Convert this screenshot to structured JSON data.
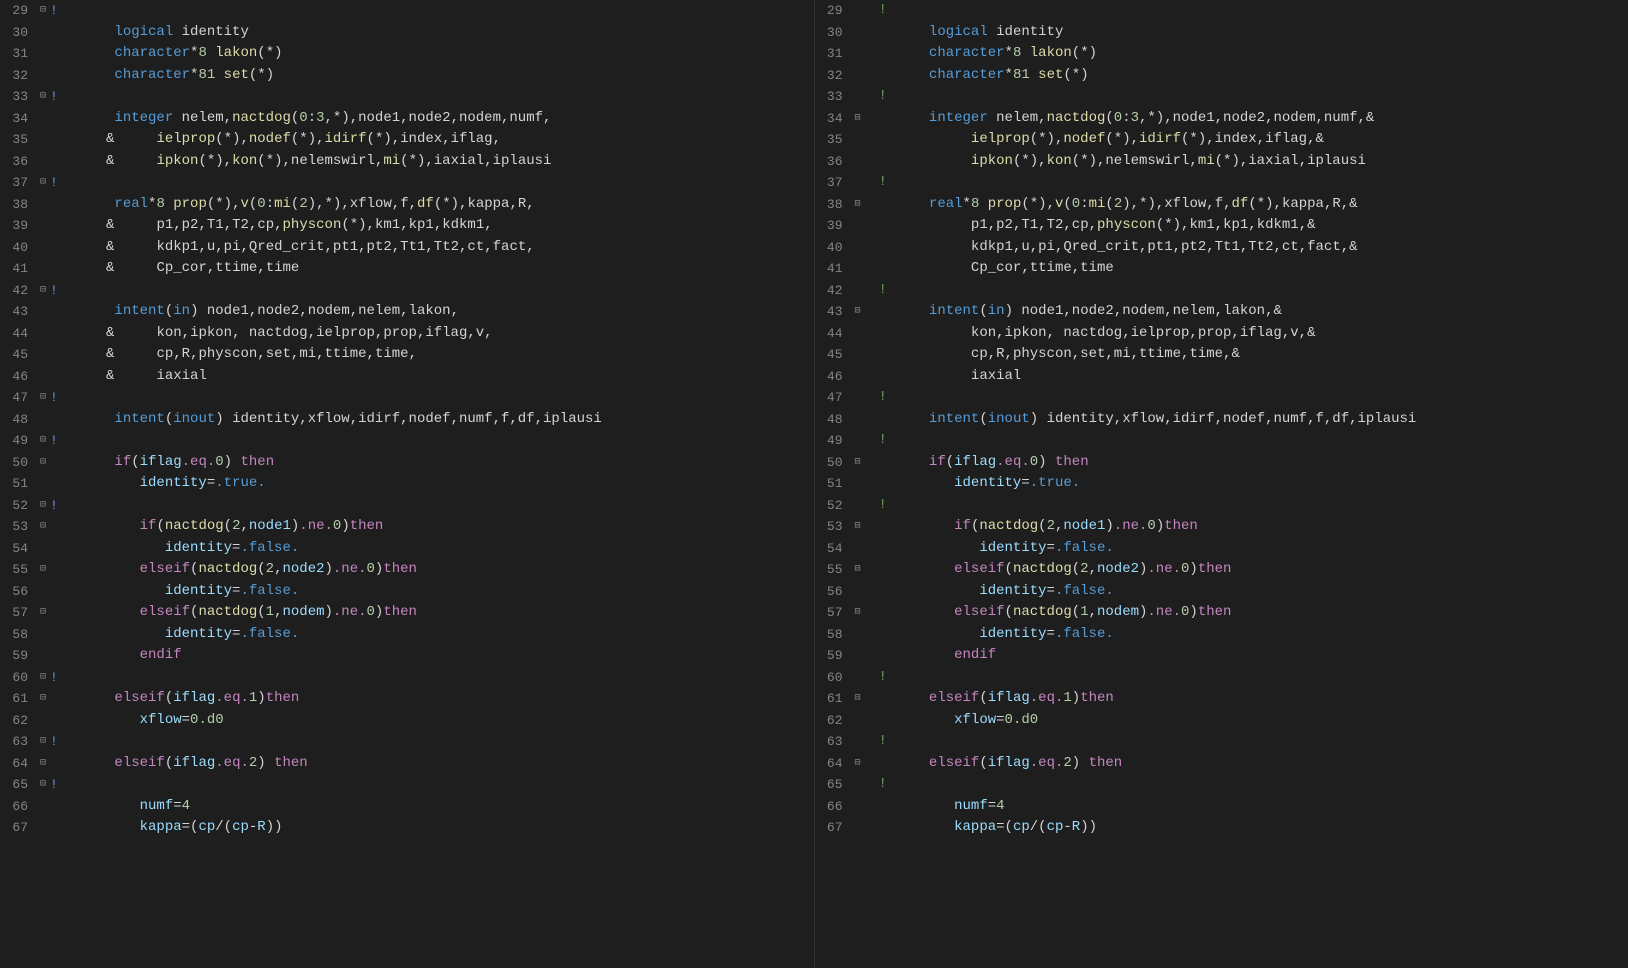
{
  "left": {
    "start": 29,
    "lines": [
      {
        "n": 29,
        "fold": "⊟",
        "mark": "!",
        "html": "<span class='cm'></span>"
      },
      {
        "n": 30,
        "fold": "",
        "mark": "",
        "html": "      <span class='kw'>logical</span> <span class='id'>identity</span>"
      },
      {
        "n": 31,
        "fold": "",
        "mark": "",
        "html": "      <span class='kw'>character</span><span class='op'>*</span><span class='num'>8</span> <span class='fn'>lakon</span>(<span class='op'>*</span>)"
      },
      {
        "n": 32,
        "fold": "",
        "mark": "",
        "html": "      <span class='kw'>character</span><span class='op'>*</span><span class='num'>81</span> <span class='fn'>set</span>(<span class='op'>*</span>)"
      },
      {
        "n": 33,
        "fold": "⊟",
        "mark": "!",
        "html": ""
      },
      {
        "n": 34,
        "fold": "",
        "mark": "",
        "html": "      <span class='kw'>integer</span> <span class='id'>nelem</span>,<span class='fn'>nactdog</span>(<span class='num'>0</span>:<span class='num'>3</span>,<span class='op'>*</span>),<span class='id'>node1</span>,<span class='id'>node2</span>,<span class='id'>nodem</span>,<span class='id'>numf</span>,"
      },
      {
        "n": 35,
        "fold": "",
        "mark": "",
        "html": "     <span class='op'>&amp;</span>     <span class='fn'>ielprop</span>(<span class='op'>*</span>),<span class='fn'>nodef</span>(<span class='op'>*</span>),<span class='fn'>idirf</span>(<span class='op'>*</span>),<span class='id'>index</span>,<span class='id'>iflag</span>,"
      },
      {
        "n": 36,
        "fold": "",
        "mark": "",
        "html": "     <span class='op'>&amp;</span>     <span class='fn'>ipkon</span>(<span class='op'>*</span>),<span class='fn'>kon</span>(<span class='op'>*</span>),<span class='id'>nelemswirl</span>,<span class='fn'>mi</span>(<span class='op'>*</span>),<span class='id'>iaxial</span>,<span class='id'>iplausi</span>"
      },
      {
        "n": 37,
        "fold": "⊟",
        "mark": "!",
        "html": ""
      },
      {
        "n": 38,
        "fold": "",
        "mark": "",
        "html": "      <span class='kw'>real</span><span class='op'>*</span><span class='num'>8</span> <span class='fn'>prop</span>(<span class='op'>*</span>),<span class='fn'>v</span>(<span class='num'>0</span>:<span class='fn'>mi</span>(<span class='num'>2</span>),<span class='op'>*</span>),<span class='id'>xflow</span>,<span class='id'>f</span>,<span class='fn'>df</span>(<span class='op'>*</span>),<span class='id'>kappa</span>,<span class='id'>R</span>,"
      },
      {
        "n": 39,
        "fold": "",
        "mark": "",
        "html": "     <span class='op'>&amp;</span>     <span class='id'>p1</span>,<span class='id'>p2</span>,<span class='id'>T1</span>,<span class='id'>T2</span>,<span class='id'>cp</span>,<span class='fn'>physcon</span>(<span class='op'>*</span>),<span class='id'>km1</span>,<span class='id'>kp1</span>,<span class='id'>kdkm1</span>,"
      },
      {
        "n": 40,
        "fold": "",
        "mark": "",
        "html": "     <span class='op'>&amp;</span>     <span class='id'>kdkp1</span>,<span class='id'>u</span>,<span class='id'>pi</span>,<span class='id'>Qred_crit</span>,<span class='id'>pt1</span>,<span class='id'>pt2</span>,<span class='id'>Tt1</span>,<span class='id'>Tt2</span>,<span class='id'>ct</span>,<span class='id'>fact</span>,"
      },
      {
        "n": 41,
        "fold": "",
        "mark": "",
        "html": "     <span class='op'>&amp;</span>     <span class='id'>Cp_cor</span>,<span class='id'>ttime</span>,<span class='id'>time</span>"
      },
      {
        "n": 42,
        "fold": "⊟",
        "mark": "!",
        "html": ""
      },
      {
        "n": 43,
        "fold": "",
        "mark": "",
        "html": "      <span class='kw'>intent</span>(<span class='kw'>in</span>) <span class='id'>node1</span>,<span class='id'>node2</span>,<span class='id'>nodem</span>,<span class='id'>nelem</span>,<span class='id'>lakon</span>,"
      },
      {
        "n": 44,
        "fold": "",
        "mark": "",
        "html": "     <span class='op'>&amp;</span>     <span class='id'>kon</span>,<span class='id'>ipkon</span>, <span class='id'>nactdog</span>,<span class='id'>ielprop</span>,<span class='id'>prop</span>,<span class='id'>iflag</span>,<span class='id'>v</span>,"
      },
      {
        "n": 45,
        "fold": "",
        "mark": "",
        "html": "     <span class='op'>&amp;</span>     <span class='id'>cp</span>,<span class='id'>R</span>,<span class='id'>physcon</span>,<span class='id'>set</span>,<span class='id'>mi</span>,<span class='id'>ttime</span>,<span class='id'>time</span>,"
      },
      {
        "n": 46,
        "fold": "",
        "mark": "",
        "html": "     <span class='op'>&amp;</span>     <span class='id'>iaxial</span>"
      },
      {
        "n": 47,
        "fold": "⊟",
        "mark": "!",
        "html": ""
      },
      {
        "n": 48,
        "fold": "",
        "mark": "",
        "html": "      <span class='kw'>intent</span>(<span class='kw'>inout</span>) <span class='id'>identity</span>,<span class='id'>xflow</span>,<span class='id'>idirf</span>,<span class='id'>nodef</span>,<span class='id'>numf</span>,<span class='id'>f</span>,<span class='id'>df</span>,<span class='id'>iplausi</span>"
      },
      {
        "n": 49,
        "fold": "⊟",
        "mark": "!",
        "html": ""
      },
      {
        "n": 50,
        "fold": "⊟",
        "mark": "",
        "html": "      <span class='kw2'>if</span>(<span class='var'>iflag</span><span class='kw2'>.eq.</span><span class='num'>0</span>) <span class='kw2'>then</span>"
      },
      {
        "n": 51,
        "fold": "",
        "mark": "",
        "html": "         <span class='var'>identity</span><span class='op'>=</span><span class='bool'>.true.</span>"
      },
      {
        "n": 52,
        "fold": "⊟",
        "mark": "!",
        "html": ""
      },
      {
        "n": 53,
        "fold": "⊟",
        "mark": "",
        "html": "         <span class='kw2'>if</span>(<span class='fn'>nactdog</span>(<span class='num'>2</span>,<span class='var'>node1</span>)<span class='kw2'>.ne.</span><span class='num'>0</span>)<span class='kw2'>then</span>"
      },
      {
        "n": 54,
        "fold": "",
        "mark": "",
        "html": "            <span class='var'>identity</span><span class='op'>=</span><span class='bool'>.false.</span>"
      },
      {
        "n": 55,
        "fold": "⊟",
        "mark": "",
        "html": "         <span class='kw2'>elseif</span>(<span class='fn'>nactdog</span>(<span class='num'>2</span>,<span class='var'>node2</span>)<span class='kw2'>.ne.</span><span class='num'>0</span>)<span class='kw2'>then</span>"
      },
      {
        "n": 56,
        "fold": "",
        "mark": "",
        "html": "            <span class='var'>identity</span><span class='op'>=</span><span class='bool'>.false.</span>"
      },
      {
        "n": 57,
        "fold": "⊟",
        "mark": "",
        "html": "         <span class='kw2'>elseif</span>(<span class='fn'>nactdog</span>(<span class='num'>1</span>,<span class='var'>nodem</span>)<span class='kw2'>.ne.</span><span class='num'>0</span>)<span class='kw2'>then</span>"
      },
      {
        "n": 58,
        "fold": "",
        "mark": "",
        "html": "            <span class='var'>identity</span><span class='op'>=</span><span class='bool'>.false.</span>"
      },
      {
        "n": 59,
        "fold": "",
        "mark": "",
        "html": "         <span class='kw2'>endif</span>"
      },
      {
        "n": 60,
        "fold": "⊟",
        "mark": "!",
        "html": ""
      },
      {
        "n": 61,
        "fold": "⊟",
        "mark": "",
        "html": "      <span class='kw2'>elseif</span>(<span class='var'>iflag</span><span class='kw2'>.eq.</span><span class='num'>1</span>)<span class='kw2'>then</span>"
      },
      {
        "n": 62,
        "fold": "",
        "mark": "",
        "html": "         <span class='var'>xflow</span><span class='op'>=</span><span class='num'>0.d0</span>"
      },
      {
        "n": 63,
        "fold": "⊟",
        "mark": "!",
        "html": ""
      },
      {
        "n": 64,
        "fold": "⊟",
        "mark": "",
        "html": "      <span class='kw2'>elseif</span>(<span class='var'>iflag</span><span class='kw2'>.eq.</span><span class='num'>2</span>) <span class='kw2'>then</span>"
      },
      {
        "n": 65,
        "fold": "⊟",
        "mark": "!",
        "html": ""
      },
      {
        "n": 66,
        "fold": "",
        "mark": "",
        "html": "         <span class='var'>numf</span><span class='op'>=</span><span class='num'>4</span>"
      },
      {
        "n": 67,
        "fold": "",
        "mark": "",
        "html": "         <span class='var'>kappa</span><span class='op'>=</span>(<span class='var'>cp</span><span class='op'>/</span>(<span class='var'>cp</span><span class='op'>-</span><span class='var'>R</span>))"
      }
    ]
  },
  "right": {
    "start": 29,
    "lines": [
      {
        "n": 29,
        "fold": "",
        "mark": "",
        "html": "<span class='cm'>!</span>"
      },
      {
        "n": 30,
        "fold": "",
        "mark": "",
        "html": "      <span class='kw'>logical</span> <span class='id'>identity</span>"
      },
      {
        "n": 31,
        "fold": "",
        "mark": "",
        "html": "      <span class='kw'>character</span><span class='op'>*</span><span class='num'>8</span> <span class='fn'>lakon</span>(<span class='op'>*</span>)"
      },
      {
        "n": 32,
        "fold": "",
        "mark": "",
        "html": "      <span class='kw'>character</span><span class='op'>*</span><span class='num'>81</span> <span class='fn'>set</span>(<span class='op'>*</span>)"
      },
      {
        "n": 33,
        "fold": "",
        "mark": "",
        "html": "<span class='cm'>!</span>"
      },
      {
        "n": 34,
        "fold": "⊟",
        "mark": "",
        "html": "      <span class='kw'>integer</span> <span class='id'>nelem</span>,<span class='fn'>nactdog</span>(<span class='num'>0</span>:<span class='num'>3</span>,<span class='op'>*</span>),<span class='id'>node1</span>,<span class='id'>node2</span>,<span class='id'>nodem</span>,<span class='id'>numf</span>,<span class='op'>&amp;</span>"
      },
      {
        "n": 35,
        "fold": "",
        "mark": "",
        "html": "           <span class='fn'>ielprop</span>(<span class='op'>*</span>),<span class='fn'>nodef</span>(<span class='op'>*</span>),<span class='fn'>idirf</span>(<span class='op'>*</span>),<span class='id'>index</span>,<span class='id'>iflag</span>,<span class='op'>&amp;</span>"
      },
      {
        "n": 36,
        "fold": "",
        "mark": "",
        "html": "           <span class='fn'>ipkon</span>(<span class='op'>*</span>),<span class='fn'>kon</span>(<span class='op'>*</span>),<span class='id'>nelemswirl</span>,<span class='fn'>mi</span>(<span class='op'>*</span>),<span class='id'>iaxial</span>,<span class='id'>iplausi</span>"
      },
      {
        "n": 37,
        "fold": "",
        "mark": "",
        "html": "<span class='cm'>!</span>"
      },
      {
        "n": 38,
        "fold": "⊟",
        "mark": "",
        "html": "      <span class='kw'>real</span><span class='op'>*</span><span class='num'>8</span> <span class='fn'>prop</span>(<span class='op'>*</span>),<span class='fn'>v</span>(<span class='num'>0</span>:<span class='fn'>mi</span>(<span class='num'>2</span>),<span class='op'>*</span>),<span class='id'>xflow</span>,<span class='id'>f</span>,<span class='fn'>df</span>(<span class='op'>*</span>),<span class='id'>kappa</span>,<span class='id'>R</span>,<span class='op'>&amp;</span>"
      },
      {
        "n": 39,
        "fold": "",
        "mark": "",
        "html": "           <span class='id'>p1</span>,<span class='id'>p2</span>,<span class='id'>T1</span>,<span class='id'>T2</span>,<span class='id'>cp</span>,<span class='fn'>physcon</span>(<span class='op'>*</span>),<span class='id'>km1</span>,<span class='id'>kp1</span>,<span class='id'>kdkm1</span>,<span class='op'>&amp;</span>"
      },
      {
        "n": 40,
        "fold": "",
        "mark": "",
        "html": "           <span class='id'>kdkp1</span>,<span class='id'>u</span>,<span class='id'>pi</span>,<span class='id'>Qred_crit</span>,<span class='id'>pt1</span>,<span class='id'>pt2</span>,<span class='id'>Tt1</span>,<span class='id'>Tt2</span>,<span class='id'>ct</span>,<span class='id'>fact</span>,<span class='op'>&amp;</span>"
      },
      {
        "n": 41,
        "fold": "",
        "mark": "",
        "html": "           <span class='id'>Cp_cor</span>,<span class='id'>ttime</span>,<span class='id'>time</span>"
      },
      {
        "n": 42,
        "fold": "",
        "mark": "",
        "html": "<span class='cm'>!</span>"
      },
      {
        "n": 43,
        "fold": "⊟",
        "mark": "",
        "html": "      <span class='kw'>intent</span>(<span class='kw'>in</span>) <span class='id'>node1</span>,<span class='id'>node2</span>,<span class='id'>nodem</span>,<span class='id'>nelem</span>,<span class='id'>lakon</span>,<span class='op'>&amp;</span>"
      },
      {
        "n": 44,
        "fold": "",
        "mark": "",
        "html": "           <span class='id'>kon</span>,<span class='id'>ipkon</span>, <span class='id'>nactdog</span>,<span class='id'>ielprop</span>,<span class='id'>prop</span>,<span class='id'>iflag</span>,<span class='id'>v</span>,<span class='op'>&amp;</span>"
      },
      {
        "n": 45,
        "fold": "",
        "mark": "",
        "html": "           <span class='id'>cp</span>,<span class='id'>R</span>,<span class='id'>physcon</span>,<span class='id'>set</span>,<span class='id'>mi</span>,<span class='id'>ttime</span>,<span class='id'>time</span>,<span class='op'>&amp;</span>"
      },
      {
        "n": 46,
        "fold": "",
        "mark": "",
        "html": "           <span class='id'>iaxial</span>"
      },
      {
        "n": 47,
        "fold": "",
        "mark": "",
        "html": "<span class='cm'>!</span>"
      },
      {
        "n": 48,
        "fold": "",
        "mark": "",
        "html": "      <span class='kw'>intent</span>(<span class='kw'>inout</span>) <span class='id'>identity</span>,<span class='id'>xflow</span>,<span class='id'>idirf</span>,<span class='id'>nodef</span>,<span class='id'>numf</span>,<span class='id'>f</span>,<span class='id'>df</span>,<span class='id'>iplausi</span>"
      },
      {
        "n": 49,
        "fold": "",
        "mark": "",
        "html": "<span class='cm'>!</span>"
      },
      {
        "n": 50,
        "fold": "⊟",
        "mark": "",
        "html": "      <span class='kw2'>if</span>(<span class='var'>iflag</span><span class='kw2'>.eq.</span><span class='num'>0</span>) <span class='kw2'>then</span>"
      },
      {
        "n": 51,
        "fold": "",
        "mark": "",
        "html": "         <span class='var'>identity</span><span class='op'>=</span><span class='bool'>.true.</span>"
      },
      {
        "n": 52,
        "fold": "",
        "mark": "",
        "html": "<span class='cm'>!</span>"
      },
      {
        "n": 53,
        "fold": "⊟",
        "mark": "",
        "html": "         <span class='kw2'>if</span>(<span class='fn'>nactdog</span>(<span class='num'>2</span>,<span class='var'>node1</span>)<span class='kw2'>.ne.</span><span class='num'>0</span>)<span class='kw2'>then</span>"
      },
      {
        "n": 54,
        "fold": "",
        "mark": "",
        "html": "            <span class='var'>identity</span><span class='op'>=</span><span class='bool'>.false.</span>"
      },
      {
        "n": 55,
        "fold": "⊟",
        "mark": "",
        "html": "         <span class='kw2'>elseif</span>(<span class='fn'>nactdog</span>(<span class='num'>2</span>,<span class='var'>node2</span>)<span class='kw2'>.ne.</span><span class='num'>0</span>)<span class='kw2'>then</span>"
      },
      {
        "n": 56,
        "fold": "",
        "mark": "",
        "html": "            <span class='var'>identity</span><span class='op'>=</span><span class='bool'>.false.</span>"
      },
      {
        "n": 57,
        "fold": "⊟",
        "mark": "",
        "html": "         <span class='kw2'>elseif</span>(<span class='fn'>nactdog</span>(<span class='num'>1</span>,<span class='var'>nodem</span>)<span class='kw2'>.ne.</span><span class='num'>0</span>)<span class='kw2'>then</span>"
      },
      {
        "n": 58,
        "fold": "",
        "mark": "",
        "html": "            <span class='var'>identity</span><span class='op'>=</span><span class='bool'>.false.</span>"
      },
      {
        "n": 59,
        "fold": "",
        "mark": "",
        "html": "         <span class='kw2'>endif</span>"
      },
      {
        "n": 60,
        "fold": "",
        "mark": "",
        "html": "<span class='cm'>!</span>"
      },
      {
        "n": 61,
        "fold": "⊟",
        "mark": "",
        "html": "      <span class='kw2'>elseif</span>(<span class='var'>iflag</span><span class='kw2'>.eq.</span><span class='num'>1</span>)<span class='kw2'>then</span>"
      },
      {
        "n": 62,
        "fold": "",
        "mark": "",
        "html": "         <span class='var'>xflow</span><span class='op'>=</span><span class='num'>0.d0</span>"
      },
      {
        "n": 63,
        "fold": "",
        "mark": "",
        "html": "<span class='cm'>!</span>"
      },
      {
        "n": 64,
        "fold": "⊟",
        "mark": "",
        "html": "      <span class='kw2'>elseif</span>(<span class='var'>iflag</span><span class='kw2'>.eq.</span><span class='num'>2</span>) <span class='kw2'>then</span>"
      },
      {
        "n": 65,
        "fold": "",
        "mark": "",
        "html": "<span class='cm'>!</span>"
      },
      {
        "n": 66,
        "fold": "",
        "mark": "",
        "html": "         <span class='var'>numf</span><span class='op'>=</span><span class='num'>4</span>"
      },
      {
        "n": 67,
        "fold": "",
        "mark": "",
        "html": "         <span class='var'>kappa</span><span class='op'>=</span>(<span class='var'>cp</span><span class='op'>/</span>(<span class='var'>cp</span><span class='op'>-</span><span class='var'>R</span>))"
      }
    ]
  }
}
